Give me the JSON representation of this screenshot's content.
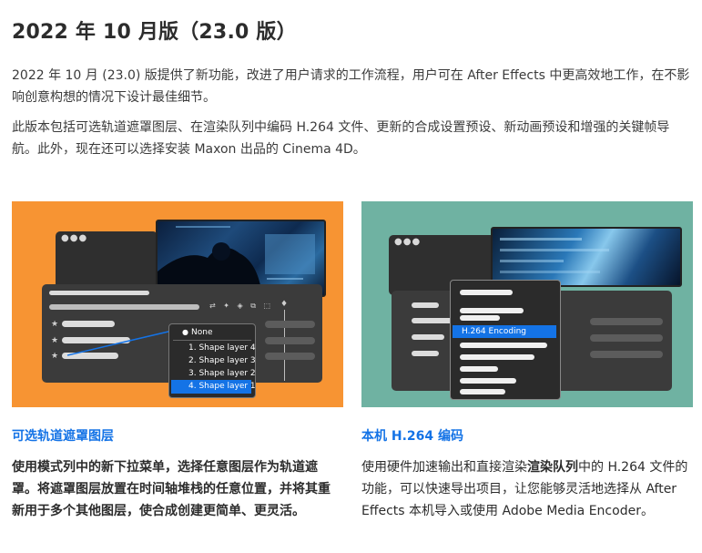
{
  "page": {
    "title": "2022 年 10 月版（23.0 版）",
    "intro_1": "2022 年 10 月 (23.0) 版提供了新功能，改进了用户请求的工作流程，用户可在 After Effects 中更高效地工作，在不影响创意构想的情况下设计最佳细节。",
    "intro_2": "此版本包括可选轨道遮罩图层、在渲染队列中编码 H.264 文件、更新的合成设置预设、新动画预设和增强的关键帧导航。此外，现在还可以选择安装 Maxon 出品的 Cinema 4D。"
  },
  "features": [
    {
      "title": "可选轨道遮罩图层",
      "text": "使用模式列中的新下拉菜单，选择任意图层作为轨道遮罩。将遮罩图层放置在时间轴堆栈的任意位置，并将其重新用于多个其他图层，使合成创建更简单、更灵活。",
      "illustration": {
        "background": "#f79433",
        "menu_items": [
          "None",
          "1. Shape layer 4",
          "2. Shape layer 3",
          "3. Shape layer 2",
          "4. Shape layer 1"
        ],
        "selected_item": "4. Shape layer 1",
        "icons": [
          "window-dots-icon",
          "star-icon",
          "toolbar-icons",
          "timeline-marker-icon"
        ]
      }
    },
    {
      "title": "本机 H.264 编码",
      "text_before": "使用硬件加速输出和直接渲染",
      "text_bold": "渲染队列",
      "text_after": "中的 H.264 文件的功能，可以快速导出项目，让您能够灵活地选择从 After Effects 本机导入或使用 Adobe Media Encoder。",
      "illustration": {
        "background": "#6fb2a2",
        "highlight_item": "H.264 Encoding",
        "icons": [
          "window-dots-icon"
        ]
      }
    }
  ]
}
